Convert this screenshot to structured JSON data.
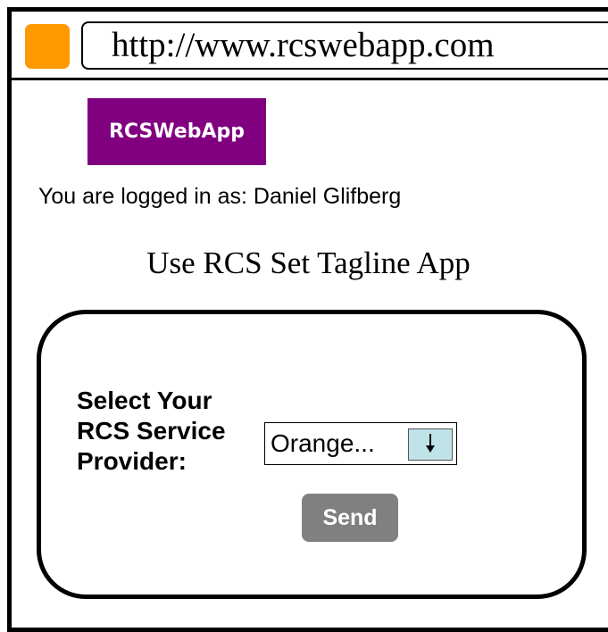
{
  "browser": {
    "url": "http://www.rcswebapp.com",
    "window_button_color": "#ff9900"
  },
  "header": {
    "logo_text": "RCSWebApp",
    "logo_color": "#800080"
  },
  "login": {
    "status_text": "You are logged in as: Daniel Glifberg"
  },
  "page": {
    "title": "Use RCS Set Tagline App"
  },
  "form": {
    "provider_label": "Select Your RCS Service Provider:",
    "provider_selected": "Orange...",
    "arrow_icon": "arrow-down-icon",
    "send_label": "Send"
  }
}
